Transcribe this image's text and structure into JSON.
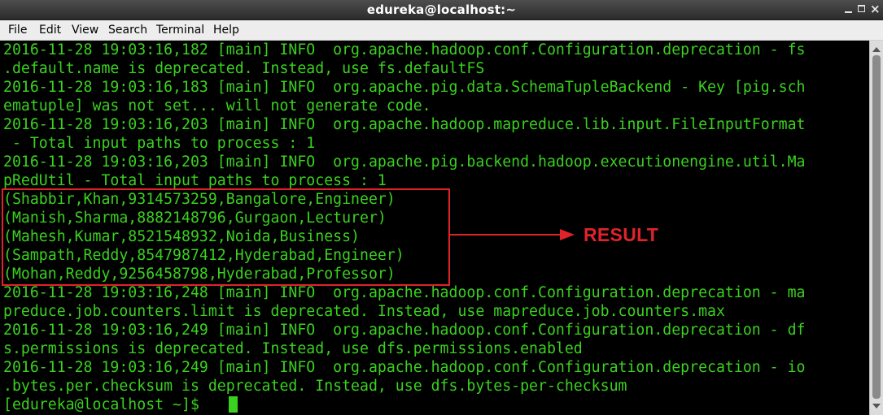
{
  "window": {
    "title": "edureka@localhost:~",
    "buttons": {
      "minimize_icon": "minimize-icon",
      "maximize_icon": "maximize-icon",
      "close_icon": "close-icon",
      "close_glyph": "×"
    }
  },
  "menu": {
    "file": "File",
    "edit": "Edit",
    "view": "View",
    "search": "Search",
    "terminal": "Terminal",
    "help": "Help"
  },
  "terminal": {
    "text_color": "#3ad11f",
    "background": "#000000",
    "lines": [
      "2016-11-28 19:03:16,182 [main] INFO  org.apache.hadoop.conf.Configuration.deprecation - fs",
      ".default.name is deprecated. Instead, use fs.defaultFS",
      "2016-11-28 19:03:16,183 [main] INFO  org.apache.pig.data.SchemaTupleBackend - Key [pig.sch",
      "ematuple] was not set... will not generate code.",
      "2016-11-28 19:03:16,203 [main] INFO  org.apache.hadoop.mapreduce.lib.input.FileInputFormat",
      " - Total input paths to process : 1",
      "2016-11-28 19:03:16,203 [main] INFO  org.apache.pig.backend.hadoop.executionengine.util.Ma",
      "pRedUtil - Total input paths to process : 1",
      "(Shabbir,Khan,9314573259,Bangalore,Engineer)",
      "(Manish,Sharma,8882148796,Gurgaon,Lecturer)",
      "(Mahesh,Kumar,8521548932,Noida,Business)",
      "(Sampath,Reddy,8547987412,Hyderabad,Engineer)",
      "(Mohan,Reddy,9256458798,Hyderabad,Professor)",
      "2016-11-28 19:03:16,248 [main] INFO  org.apache.hadoop.conf.Configuration.deprecation - ma",
      "preduce.job.counters.limit is deprecated. Instead, use mapreduce.job.counters.max",
      "2016-11-28 19:03:16,249 [main] INFO  org.apache.hadoop.conf.Configuration.deprecation - df",
      "s.permissions is deprecated. Instead, use dfs.permissions.enabled",
      "2016-11-28 19:03:16,249 [main] INFO  org.apache.hadoop.conf.Configuration.deprecation - io",
      ".bytes.per.checksum is deprecated. Instead, use dfs.bytes-per-checksum",
      "[edureka@localhost ~]$ "
    ]
  },
  "annotation": {
    "label": "RESULT",
    "color": "#e0232b"
  }
}
